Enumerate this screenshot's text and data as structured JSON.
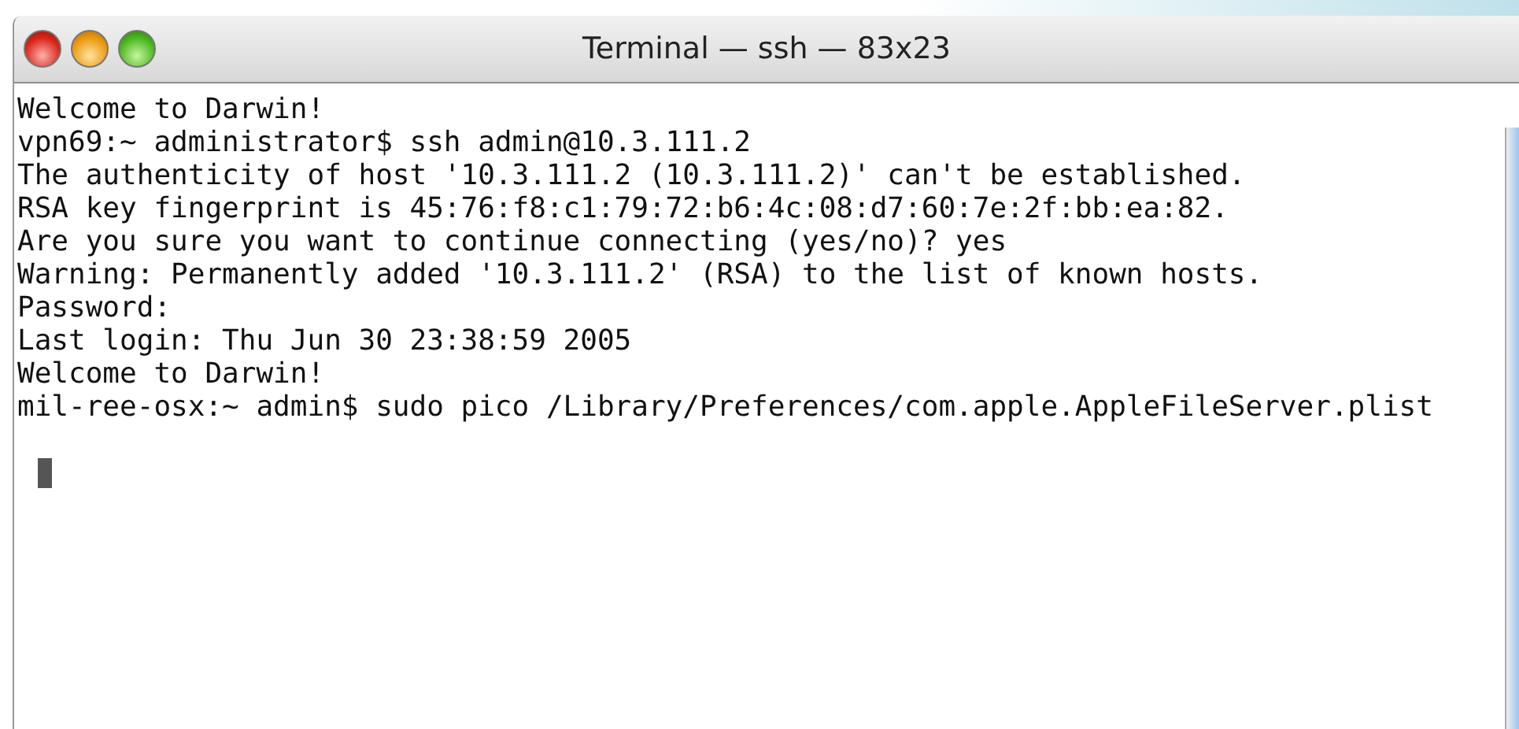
{
  "window": {
    "title": "Terminal — ssh — 83x23"
  },
  "terminal": {
    "lines": [
      "Welcome to Darwin!",
      "vpn69:~ administrator$ ssh admin@10.3.111.2",
      "The authenticity of host '10.3.111.2 (10.3.111.2)' can't be established.",
      "RSA key fingerprint is 45:76:f8:c1:79:72:b6:4c:08:d7:60:7e:2f:bb:ea:82.",
      "Are you sure you want to continue connecting (yes/no)? yes",
      "Warning: Permanently added '10.3.111.2' (RSA) to the list of known hosts.",
      "Password:",
      "Last login: Thu Jun 30 23:38:59 2005",
      "Welcome to Darwin!",
      "mil-ree-osx:~ admin$ sudo pico /Library/Preferences/com.apple.AppleFileServer.plist"
    ],
    "cursor": true
  }
}
